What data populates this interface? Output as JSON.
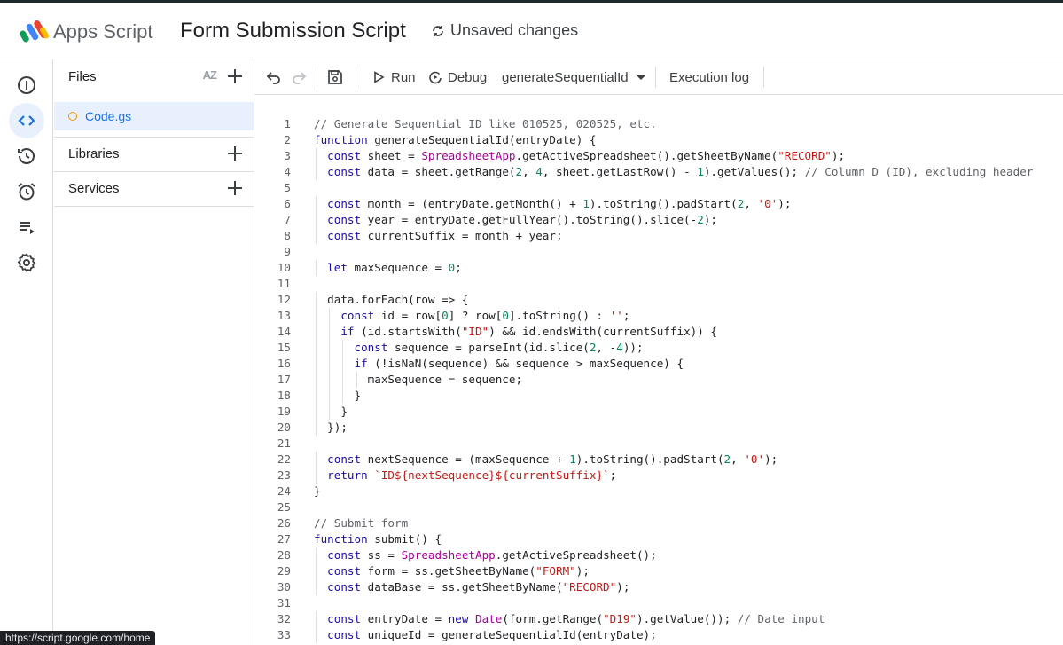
{
  "header": {
    "app_name": "Apps Script",
    "project_title": "Form Submission Script",
    "save_status": "Unsaved changes"
  },
  "rail": {
    "items": [
      {
        "icon": "info-icon",
        "label": "Overview"
      },
      {
        "icon": "code-icon",
        "label": "Editor",
        "active": true
      },
      {
        "icon": "history-icon",
        "label": "Project history"
      },
      {
        "icon": "alarm-icon",
        "label": "Triggers"
      },
      {
        "icon": "executions-icon",
        "label": "Executions"
      },
      {
        "icon": "gear-icon",
        "label": "Project Settings"
      }
    ]
  },
  "files_panel": {
    "files_label": "Files",
    "sort_label": "AZ",
    "files": [
      "Code.gs"
    ],
    "libraries_label": "Libraries",
    "services_label": "Services"
  },
  "toolbar": {
    "run_label": "Run",
    "debug_label": "Debug",
    "function_select": "generateSequentialId",
    "execution_log_label": "Execution log"
  },
  "editor": {
    "lines": [
      {
        "n": "1",
        "text": "// Generate Sequential ID like 010525, 020525, etc."
      },
      {
        "n": "2",
        "text": "function generateSequentialId(entryDate) {"
      },
      {
        "n": "3",
        "text": "  const sheet = SpreadsheetApp.getActiveSpreadsheet().getSheetByName(\"RECORD\");"
      },
      {
        "n": "4",
        "text": "  const data = sheet.getRange(2, 4, sheet.getLastRow() - 1).getValues(); // Column D (ID), excluding header"
      },
      {
        "n": "5",
        "text": ""
      },
      {
        "n": "6",
        "text": "  const month = (entryDate.getMonth() + 1).toString().padStart(2, '0');"
      },
      {
        "n": "7",
        "text": "  const year = entryDate.getFullYear().toString().slice(-2);"
      },
      {
        "n": "8",
        "text": "  const currentSuffix = month + year;"
      },
      {
        "n": "9",
        "text": ""
      },
      {
        "n": "10",
        "text": "  let maxSequence = 0;"
      },
      {
        "n": "11",
        "text": ""
      },
      {
        "n": "12",
        "text": "  data.forEach(row => {"
      },
      {
        "n": "13",
        "text": "    const id = row[0] ? row[0].toString() : '';"
      },
      {
        "n": "14",
        "text": "    if (id.startsWith(\"ID\") && id.endsWith(currentSuffix)) {"
      },
      {
        "n": "15",
        "text": "      const sequence = parseInt(id.slice(2, -4));"
      },
      {
        "n": "16",
        "text": "      if (!isNaN(sequence) && sequence > maxSequence) {"
      },
      {
        "n": "17",
        "text": "        maxSequence = sequence;"
      },
      {
        "n": "18",
        "text": "      }"
      },
      {
        "n": "19",
        "text": "    }"
      },
      {
        "n": "20",
        "text": "  });"
      },
      {
        "n": "21",
        "text": ""
      },
      {
        "n": "22",
        "text": "  const nextSequence = (maxSequence + 1).toString().padStart(2, '0');"
      },
      {
        "n": "23",
        "text": "  return `ID${nextSequence}${currentSuffix}`;"
      },
      {
        "n": "24",
        "text": "}"
      },
      {
        "n": "25",
        "text": ""
      },
      {
        "n": "26",
        "text": "// Submit form"
      },
      {
        "n": "27",
        "text": "function submit() {"
      },
      {
        "n": "28",
        "text": "  const ss = SpreadsheetApp.getActiveSpreadsheet();"
      },
      {
        "n": "29",
        "text": "  const form = ss.getSheetByName(\"FORM\");"
      },
      {
        "n": "30",
        "text": "  const dataBase = ss.getSheetByName(\"RECORD\");"
      },
      {
        "n": "31",
        "text": ""
      },
      {
        "n": "32",
        "text": "  const entryDate = new Date(form.getRange(\"D19\").getValue()); // Date input"
      },
      {
        "n": "33",
        "text": "  const uniqueId = generateSequentialId(entryDate);"
      }
    ]
  },
  "status_bar": {
    "url": "https://script.google.com/home"
  },
  "colors": {
    "accent": "#1a73e8",
    "active_bg": "#e8f0fe",
    "keyword": "#1a0dab",
    "string": "#c41a16",
    "number": "#098658",
    "comment": "#5f6368",
    "class": "#a8009c"
  }
}
